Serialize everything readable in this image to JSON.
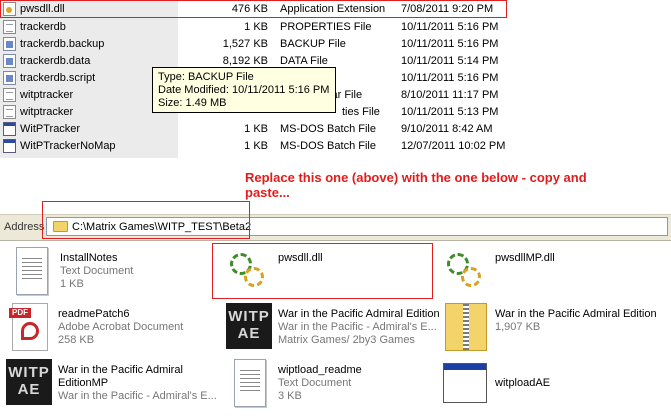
{
  "details": {
    "rows": [
      {
        "icon": "dll-icon",
        "name": "pwsdll.dll",
        "size": "476 KB",
        "type": "Application Extension",
        "date": "7/08/2011 9:20 PM"
      },
      {
        "icon": "document-icon",
        "name": "trackerdb",
        "size": "1 KB",
        "type": "PROPERTIES File",
        "date": "10/11/2011 5:16 PM"
      },
      {
        "icon": "system-file-icon",
        "name": "trackerdb.backup",
        "size": "1,527 KB",
        "type": "BACKUP File",
        "date": "10/11/2011 5:16 PM"
      },
      {
        "icon": "system-file-icon",
        "name": "trackerdb.data",
        "size": "8,192 KB",
        "type": "DATA File",
        "date": "10/11/2011 5:14 PM"
      },
      {
        "icon": "system-file-icon",
        "name": "trackerdb.script",
        "size": "",
        "type": "",
        "date": "10/11/2011 5:16 PM"
      },
      {
        "icon": "document-icon",
        "name": "witptracker",
        "size": "",
        "type": "Jar File",
        "date": "8/10/2011 11:17 PM"
      },
      {
        "icon": "document-icon",
        "name": "witptracker",
        "size": "",
        "type": "ties File",
        "date": "10/11/2011 5:13 PM"
      },
      {
        "icon": "batch-file-icon",
        "name": "WitPTracker",
        "size": "1 KB",
        "type": "MS-DOS Batch File",
        "date": "9/10/2011 8:42 AM"
      },
      {
        "icon": "batch-file-icon",
        "name": "WitPTrackerNoMap",
        "size": "1 KB",
        "type": "MS-DOS Batch File",
        "date": "12/07/2011 10:02 PM"
      }
    ]
  },
  "tooltip": {
    "type_line": "Type: BACKUP File",
    "date_line": "Date Modified: 10/11/2011 5:16 PM",
    "size_line": "Size: 1.49 MB"
  },
  "instruction": {
    "line1": "Replace this one (above) with the one below - copy and",
    "line2": "paste..."
  },
  "address": {
    "label": "Address",
    "path": "C:\\Matrix Games\\WITP_TEST\\Beta2"
  },
  "tiles": [
    {
      "name": "InstallNotes",
      "line2": "Text Document",
      "line3": "1 KB"
    },
    {
      "name": "pwsdll.dll",
      "line2": "",
      "line3": ""
    },
    {
      "name": "pwsdllMP.dll",
      "line2": "",
      "line3": ""
    },
    {
      "name": "readmePatch6",
      "line2": "Adobe Acrobat Document",
      "line3": "258 KB"
    },
    {
      "name": "War in the Pacific Admiral Edition",
      "line2": "War in the Pacific - Admiral's E...",
      "line3": "Matrix Games/ 2by3 Games",
      "logo": "WITP AE"
    },
    {
      "name": "War in the Pacific Admiral Edition",
      "line2": "1,907 KB",
      "line3": ""
    },
    {
      "name": "War in the Pacific Admiral",
      "name2": "EditionMP",
      "line2": "War in the Pacific - Admiral's E...",
      "logo": "WITP AE"
    },
    {
      "name": "wiptload_readme",
      "line2": "Text Document",
      "line3": "3 KB"
    },
    {
      "name": "witploadAE",
      "line2": "",
      "line3": ""
    }
  ],
  "colors": {
    "highlight": "#e02020",
    "instruction": "#e31b1b",
    "tooltip_bg": "#ffffe1",
    "toolbar_bg": "#ece9d8"
  }
}
